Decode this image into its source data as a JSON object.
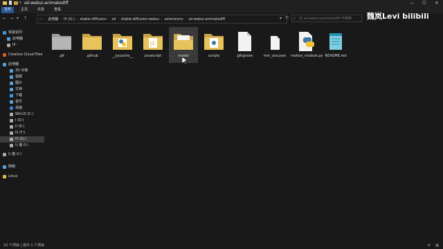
{
  "window": {
    "title": "sd-webui-animatediff",
    "controls": [
      "—",
      "☐",
      "✕"
    ]
  },
  "ribbon": {
    "tabs": [
      "文件",
      "主页",
      "共享",
      "查看"
    ]
  },
  "address": {
    "crumbs": [
      "此电脑",
      "IV (G:)",
      "stable diffusion",
      "sd",
      "stable-diffusion-webui",
      "extensions",
      "sd-webui-animatediff"
    ],
    "search_placeholder": "在 sd-webui-animatediff 中搜索"
  },
  "watermark": "魏岚Levi bilibili",
  "nav": {
    "items": [
      {
        "label": "快速访问",
        "icon": "star-icon",
        "color": "#3c9ad6"
      },
      {
        "label": "此电脑",
        "icon": "pc-icon",
        "color": "#5aa0d8"
      },
      {
        "label": "III :",
        "icon": "drive-icon",
        "color": "#aaa"
      },
      {
        "label": "Creative Cloud Files",
        "icon": "cloud-icon",
        "color": "#e05a2b"
      },
      {
        "label": "此电脑",
        "icon": "pc-icon",
        "color": "#5aa0d8"
      },
      {
        "label": "3D 对象",
        "icon": "cube-icon",
        "color": "#5aa0d8"
      },
      {
        "label": "视频",
        "icon": "video-icon",
        "color": "#5aa0d8"
      },
      {
        "label": "图片",
        "icon": "picture-icon",
        "color": "#5aa0d8"
      },
      {
        "label": "文档",
        "icon": "document-icon",
        "color": "#5aa0d8"
      },
      {
        "label": "下载",
        "icon": "download-icon",
        "color": "#3c9ad6"
      },
      {
        "label": "音乐",
        "icon": "music-icon",
        "color": "#5aa0d8"
      },
      {
        "label": "桌面",
        "icon": "desktop-icon",
        "color": "#3c7ad6"
      },
      {
        "label": "Win10 (C:)",
        "icon": "drive-icon",
        "color": "#aaa"
      },
      {
        "label": "I (D:)",
        "icon": "drive-icon",
        "color": "#aaa"
      },
      {
        "label": "II (E:)",
        "icon": "drive-icon",
        "color": "#aaa"
      },
      {
        "label": "III (F:)",
        "icon": "drive-icon",
        "color": "#aaa"
      },
      {
        "label": "IV (G:)",
        "icon": "drive-icon",
        "color": "#aaa"
      },
      {
        "label": "U 盘 (I:)",
        "icon": "usb-icon",
        "color": "#aaa"
      },
      {
        "label": "U 盘 (I:)",
        "icon": "usb-icon",
        "color": "#aaa"
      },
      {
        "label": "网络",
        "icon": "network-icon",
        "color": "#5aa0d8"
      },
      {
        "label": "Linux",
        "icon": "linux-icon",
        "color": "#e0c040"
      }
    ]
  },
  "files": [
    {
      "name": ".git",
      "kind": "folder-grey"
    },
    {
      "name": ".github",
      "kind": "folder"
    },
    {
      "name": "__pycache__",
      "kind": "folder-python"
    },
    {
      "name": "javascript",
      "kind": "folder-js"
    },
    {
      "name": "model",
      "kind": "folder-open"
    },
    {
      "name": "scripts",
      "kind": "folder-doc"
    },
    {
      "name": ".gitignore",
      "kind": "file"
    },
    {
      "name": "mm_zoo.json",
      "kind": "file-small"
    },
    {
      "name": "motion_module.py",
      "kind": "python"
    },
    {
      "name": "README.md",
      "kind": "notepad"
    }
  ],
  "status": {
    "text": "10 个项目 | 选中 1 个项目"
  },
  "colors": {
    "accent": "#2b5797",
    "folder": "#e8c25a",
    "bg": "#191919"
  }
}
